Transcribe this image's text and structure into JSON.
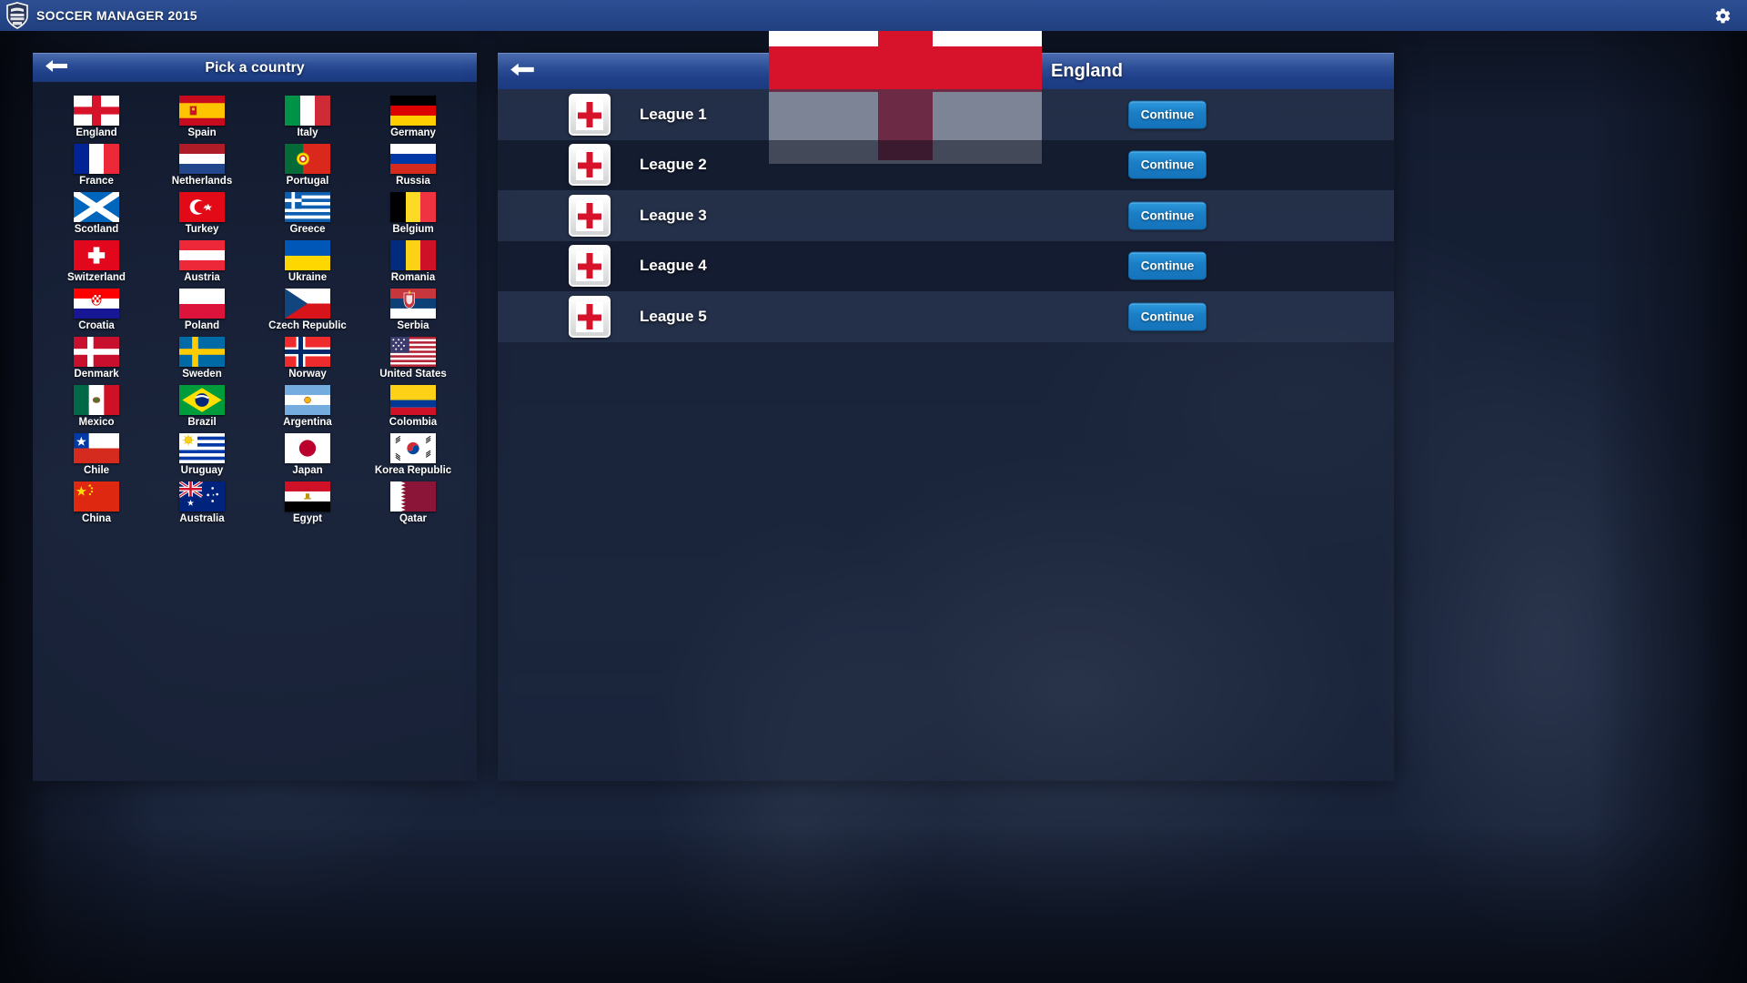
{
  "app": {
    "title": "SOCCER MANAGER 2015",
    "logo_icon": "shield-logo-icon",
    "settings_icon": "gear-icon",
    "topbar_color": "#27488b"
  },
  "left_panel": {
    "title": "Pick a country",
    "back_icon": "back-arrow-icon",
    "countries": [
      {
        "name": "England",
        "flag": "england"
      },
      {
        "name": "Spain",
        "flag": "spain"
      },
      {
        "name": "Italy",
        "flag": "italy"
      },
      {
        "name": "Germany",
        "flag": "germany"
      },
      {
        "name": "France",
        "flag": "france"
      },
      {
        "name": "Netherlands",
        "flag": "netherlands"
      },
      {
        "name": "Portugal",
        "flag": "portugal"
      },
      {
        "name": "Russia",
        "flag": "russia"
      },
      {
        "name": "Scotland",
        "flag": "scotland"
      },
      {
        "name": "Turkey",
        "flag": "turkey"
      },
      {
        "name": "Greece",
        "flag": "greece"
      },
      {
        "name": "Belgium",
        "flag": "belgium"
      },
      {
        "name": "Switzerland",
        "flag": "switzerland"
      },
      {
        "name": "Austria",
        "flag": "austria"
      },
      {
        "name": "Ukraine",
        "flag": "ukraine"
      },
      {
        "name": "Romania",
        "flag": "romania"
      },
      {
        "name": "Croatia",
        "flag": "croatia"
      },
      {
        "name": "Poland",
        "flag": "poland"
      },
      {
        "name": "Czech Republic",
        "flag": "czech"
      },
      {
        "name": "Serbia",
        "flag": "serbia"
      },
      {
        "name": "Denmark",
        "flag": "denmark"
      },
      {
        "name": "Sweden",
        "flag": "sweden"
      },
      {
        "name": "Norway",
        "flag": "norway"
      },
      {
        "name": "United States",
        "flag": "usa"
      },
      {
        "name": "Mexico",
        "flag": "mexico"
      },
      {
        "name": "Brazil",
        "flag": "brazil"
      },
      {
        "name": "Argentina",
        "flag": "argentina"
      },
      {
        "name": "Colombia",
        "flag": "colombia"
      },
      {
        "name": "Chile",
        "flag": "chile"
      },
      {
        "name": "Uruguay",
        "flag": "uruguay"
      },
      {
        "name": "Japan",
        "flag": "japan"
      },
      {
        "name": "Korea Republic",
        "flag": "korea"
      },
      {
        "name": "China",
        "flag": "china"
      },
      {
        "name": "Australia",
        "flag": "australia"
      },
      {
        "name": "Egypt",
        "flag": "egypt"
      },
      {
        "name": "Qatar",
        "flag": "qatar"
      }
    ]
  },
  "right_panel": {
    "country": "England",
    "country_flag": "england",
    "back_icon": "back-arrow-icon",
    "continue_label": "Continue",
    "button_color": "#1b7fc6",
    "leagues": [
      {
        "name": "League 1",
        "badge": "england"
      },
      {
        "name": "League 2",
        "badge": "england"
      },
      {
        "name": "League 3",
        "badge": "england"
      },
      {
        "name": "League 4",
        "badge": "england"
      },
      {
        "name": "League 5",
        "badge": "england"
      }
    ]
  }
}
